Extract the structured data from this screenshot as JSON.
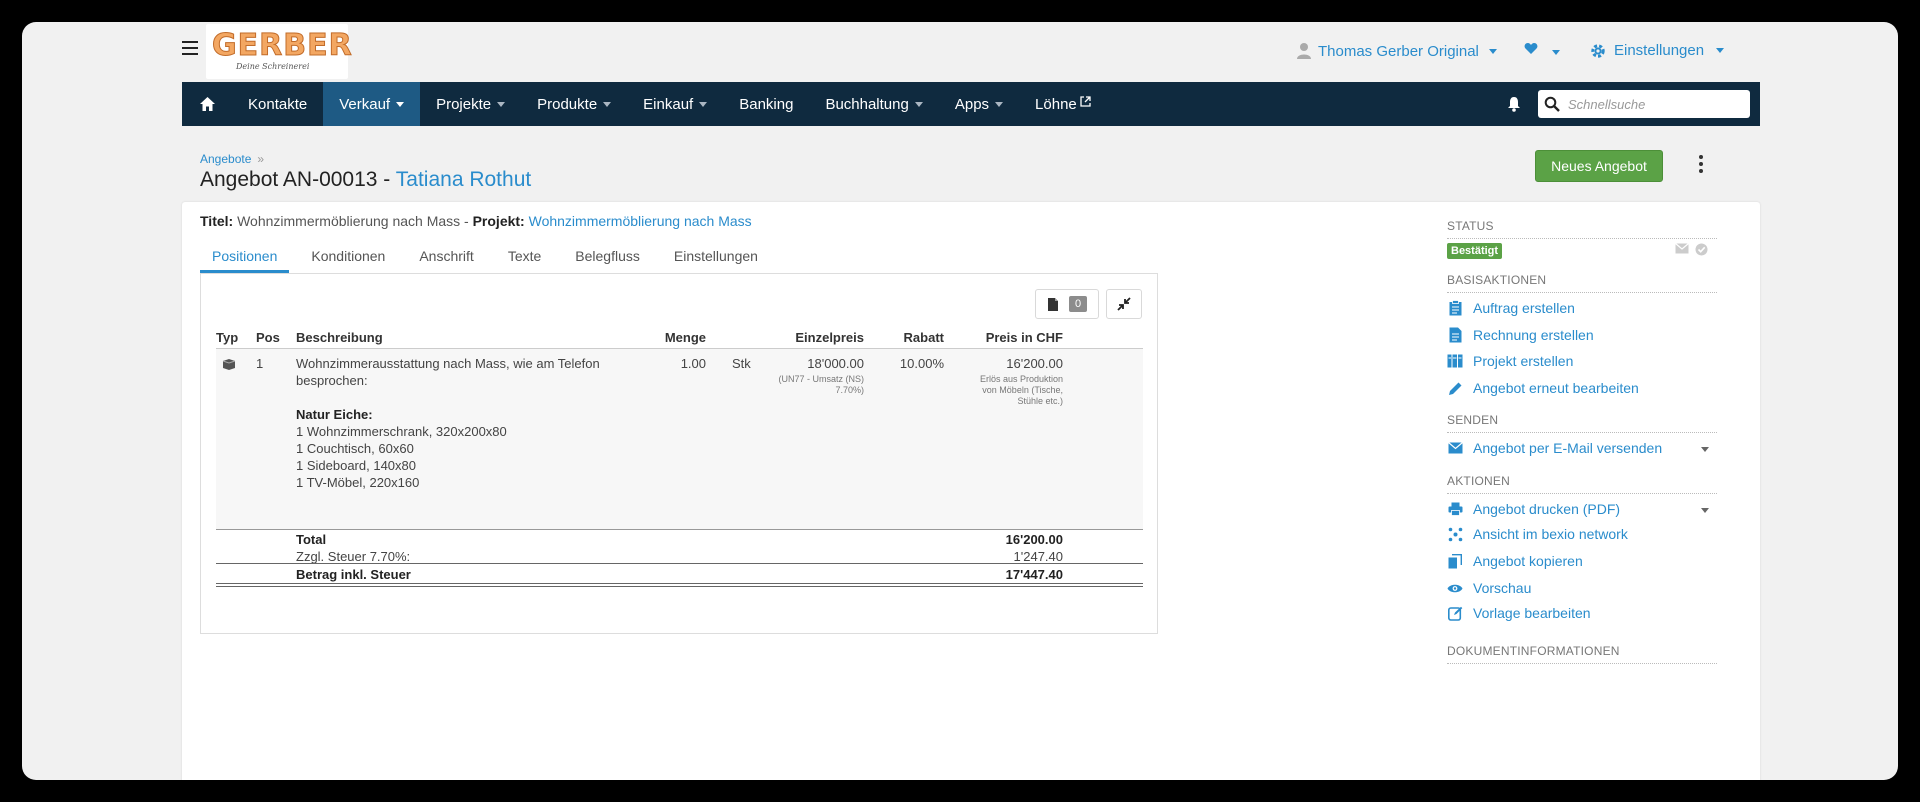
{
  "brand": {
    "logo_word": "GERBER",
    "logo_sub": "Deine Schreinerei"
  },
  "topbar": {
    "user_name": "Thomas Gerber Original",
    "settings_label": "Einstellungen"
  },
  "nav": {
    "items": [
      {
        "label": "Kontakte"
      },
      {
        "label": "Verkauf"
      },
      {
        "label": "Projekte"
      },
      {
        "label": "Produkte"
      },
      {
        "label": "Einkauf"
      },
      {
        "label": "Banking"
      },
      {
        "label": "Buchhaltung"
      },
      {
        "label": "Apps"
      },
      {
        "label": "Löhne"
      }
    ],
    "search_placeholder": "Schnellsuche"
  },
  "header": {
    "breadcrumb": "Angebote",
    "breadcrumb_sep": "»",
    "title_prefix": "Angebot AN-00013 -",
    "client": "Tatiana Rothut",
    "new_button": "Neues Angebot"
  },
  "meta": {
    "title_label": "Titel:",
    "title_value": "Wohnzimmermöblierung nach Mass -",
    "project_label": "Projekt:",
    "project_value": "Wohnzimmermöblierung nach Mass"
  },
  "tabs": [
    {
      "label": "Positionen"
    },
    {
      "label": "Konditionen"
    },
    {
      "label": "Anschrift"
    },
    {
      "label": "Texte"
    },
    {
      "label": "Belegfluss"
    },
    {
      "label": "Einstellungen"
    }
  ],
  "doc_count": "0",
  "table": {
    "headers": {
      "typ": "Typ",
      "pos": "Pos",
      "beschreibung": "Beschreibung",
      "menge": "Menge",
      "einzelpreis": "Einzelpreis",
      "rabatt": "Rabatt",
      "preis": "Preis in CHF"
    },
    "row": {
      "pos": "1",
      "desc_line1": "Wohnzimmerausstattung nach Mass, wie am Telefon",
      "desc_line2": "besprochen:",
      "desc_heading": "Natur Eiche:",
      "desc_items": [
        "1 Wohnzimmerschrank, 320x200x80",
        "1 Couchtisch, 60x60",
        "1 Sideboard, 140x80",
        "1 TV-Möbel, 220x160"
      ],
      "menge": "1.00",
      "unit": "Stk",
      "einzelpreis": "18'000.00",
      "tax_note_1": "(UN77 - Umsatz (NS)",
      "tax_note_2": "7.70%)",
      "rabatt": "10.00%",
      "preis": "16'200.00",
      "account_note_1": "Erlös aus Produktion",
      "account_note_2": "von Möbeln (Tische,",
      "account_note_3": "Stühle etc.)"
    },
    "totals": {
      "total_label": "Total",
      "total_value": "16'200.00",
      "tax_label": "Zzgl. Steuer 7.70%:",
      "tax_value": "1'247.40",
      "grand_label": "Betrag inkl. Steuer",
      "grand_value": "17'447.40"
    }
  },
  "sidebar": {
    "status_heading": "Status",
    "status_badge": "Bestätigt",
    "basis_heading": "Basisaktionen",
    "basis": [
      {
        "label": "Auftrag erstellen"
      },
      {
        "label": "Rechnung erstellen"
      },
      {
        "label": "Projekt erstellen"
      },
      {
        "label": "Angebot erneut bearbeiten"
      }
    ],
    "senden_heading": "Senden",
    "senden": [
      {
        "label": "Angebot per E-Mail versenden"
      }
    ],
    "aktionen_heading": "Aktionen",
    "aktionen": [
      {
        "label": "Angebot drucken (PDF)"
      },
      {
        "label": "Ansicht im bexio network"
      },
      {
        "label": "Angebot kopieren"
      },
      {
        "label": "Vorschau"
      },
      {
        "label": "Vorlage bearbeiten"
      }
    ],
    "docinfo_heading": "Dokumentinformationen"
  },
  "colors": {
    "accent": "#2a8ccc",
    "navbar": "#0f2a3f",
    "nav_active": "#1e5a84",
    "success": "#5ba246"
  }
}
